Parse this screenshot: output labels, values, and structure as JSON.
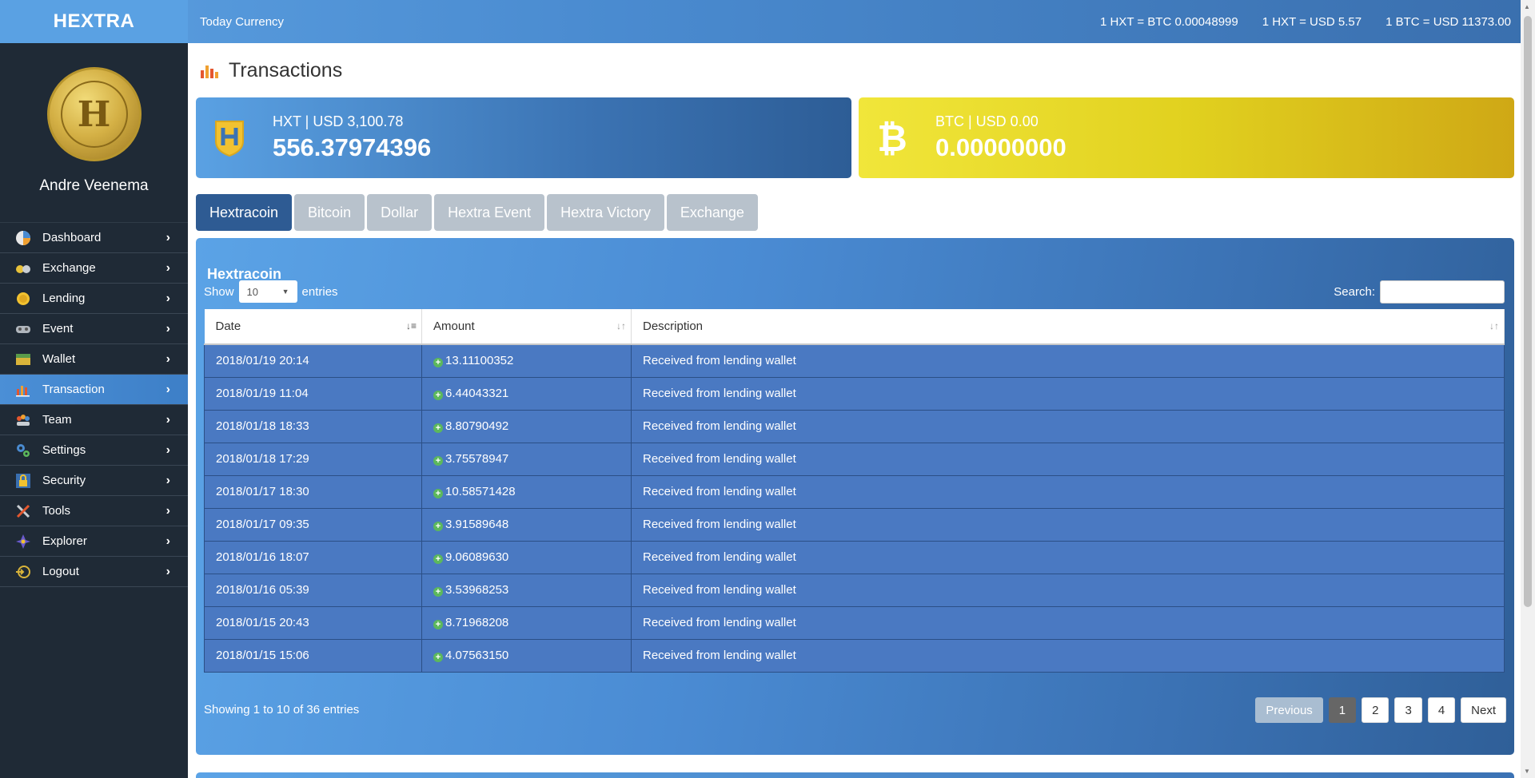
{
  "brand": "HEXTRA",
  "header": {
    "today_label": "Today Currency",
    "rates": [
      "1 HXT = BTC 0.00048999",
      "1 HXT = USD 5.57",
      "1 BTC = USD 11373.00"
    ]
  },
  "user": {
    "name": "Andre Veenema"
  },
  "sidebar": {
    "items": [
      {
        "label": "Dashboard",
        "icon": "dashboard-icon"
      },
      {
        "label": "Exchange",
        "icon": "exchange-icon"
      },
      {
        "label": "Lending",
        "icon": "lending-icon"
      },
      {
        "label": "Event",
        "icon": "event-icon"
      },
      {
        "label": "Wallet",
        "icon": "wallet-icon"
      },
      {
        "label": "Transaction",
        "icon": "transaction-icon",
        "active": true
      },
      {
        "label": "Team",
        "icon": "team-icon"
      },
      {
        "label": "Settings",
        "icon": "settings-icon"
      },
      {
        "label": "Security",
        "icon": "security-icon"
      },
      {
        "label": "Tools",
        "icon": "tools-icon"
      },
      {
        "label": "Explorer",
        "icon": "explorer-icon"
      },
      {
        "label": "Logout",
        "icon": "logout-icon"
      }
    ]
  },
  "page": {
    "title": "Transactions"
  },
  "cards": {
    "hxt": {
      "label": "HXT | USD 3,100.78",
      "amount": "556.37974396"
    },
    "btc": {
      "label": "BTC | USD 0.00",
      "amount": "0.00000000"
    }
  },
  "tabs": [
    "Hextracoin",
    "Bitcoin",
    "Dollar",
    "Hextra Event",
    "Hextra Victory",
    "Exchange"
  ],
  "panel": {
    "title": "Hextracoin",
    "show_label": "Show",
    "entries_value": "10",
    "entries_label": "entries",
    "search_label": "Search:"
  },
  "table": {
    "headers": [
      "Date",
      "Amount",
      "Description"
    ],
    "rows": [
      {
        "date": "2018/01/19 20:14",
        "amount": "13.11100352",
        "desc": "Received from lending wallet"
      },
      {
        "date": "2018/01/19 11:04",
        "amount": "6.44043321",
        "desc": "Received from lending wallet"
      },
      {
        "date": "2018/01/18 18:33",
        "amount": "8.80790492",
        "desc": "Received from lending wallet"
      },
      {
        "date": "2018/01/18 17:29",
        "amount": "3.75578947",
        "desc": "Received from lending wallet"
      },
      {
        "date": "2018/01/17 18:30",
        "amount": "10.58571428",
        "desc": "Received from lending wallet"
      },
      {
        "date": "2018/01/17 09:35",
        "amount": "3.91589648",
        "desc": "Received from lending wallet"
      },
      {
        "date": "2018/01/16 18:07",
        "amount": "9.06089630",
        "desc": "Received from lending wallet"
      },
      {
        "date": "2018/01/16 05:39",
        "amount": "3.53968253",
        "desc": "Received from lending wallet"
      },
      {
        "date": "2018/01/15 20:43",
        "amount": "8.71968208",
        "desc": "Received from lending wallet"
      },
      {
        "date": "2018/01/15 15:06",
        "amount": "4.07563150",
        "desc": "Received from lending wallet"
      }
    ]
  },
  "footer": {
    "info": "Showing 1 to 10 of 36 entries",
    "pager": [
      "Previous",
      "1",
      "2",
      "3",
      "4",
      "Next"
    ]
  },
  "colors": {
    "accent_blue": "#4a8bd0",
    "sidebar_bg": "#1f2a36",
    "btc_yellow": "#e1d11f",
    "tab_active": "#2e5b93"
  }
}
